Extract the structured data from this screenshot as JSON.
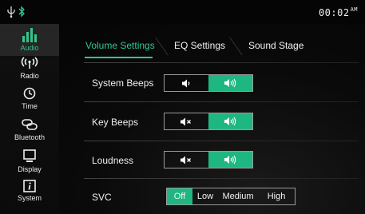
{
  "status": {
    "time": "00:02",
    "ampm": "AM"
  },
  "sidebar": {
    "items": [
      {
        "label": "Audio",
        "icon": "audio-bars-icon",
        "active": true
      },
      {
        "label": "Radio",
        "icon": "radio-signal-icon",
        "active": false
      },
      {
        "label": "Time",
        "icon": "clock-icon",
        "active": false
      },
      {
        "label": "Bluetooth",
        "icon": "bluetooth-icon",
        "active": false
      },
      {
        "label": "Display",
        "icon": "monitor-icon",
        "active": false
      },
      {
        "label": "System",
        "icon": "info-icon",
        "active": false
      }
    ]
  },
  "tabs": [
    {
      "label": "Volume Settings",
      "active": true
    },
    {
      "label": "EQ Settings",
      "active": false
    },
    {
      "label": "Sound Stage",
      "active": false
    }
  ],
  "settings": {
    "system_beeps": {
      "label": "System Beeps",
      "off_icon": "speaker-low-icon",
      "on_icon": "speaker-high-icon",
      "selected": "on"
    },
    "key_beeps": {
      "label": "Key Beeps",
      "off_icon": "speaker-mute-icon",
      "on_icon": "speaker-high-icon",
      "selected": "on"
    },
    "loudness": {
      "label": "Loudness",
      "off_icon": "speaker-mute-icon",
      "on_icon": "speaker-high-icon",
      "selected": "on"
    },
    "svc": {
      "label": "SVC",
      "options": [
        "Off",
        "Low",
        "Medium",
        "High"
      ],
      "selected": "Off"
    }
  },
  "colors": {
    "accent": "#1fb781",
    "accent_text": "#2ec98e",
    "background": "#000000"
  }
}
